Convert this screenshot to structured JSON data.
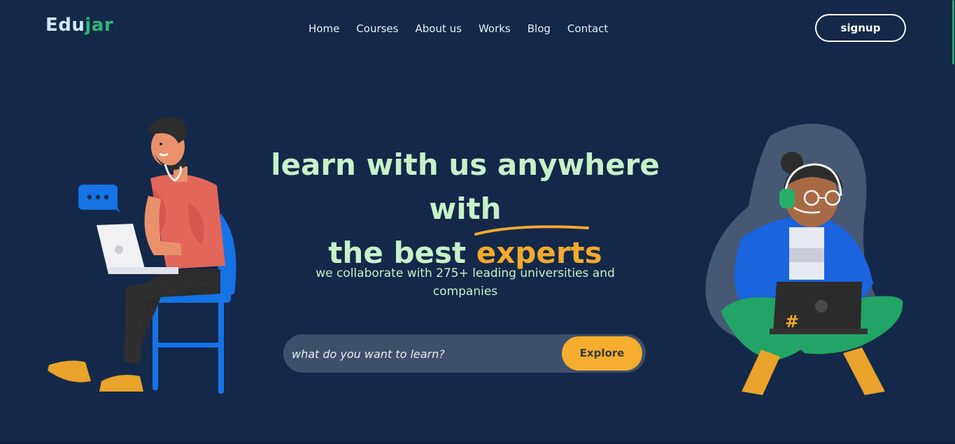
{
  "header": {
    "logo_part1": "Edu",
    "logo_part2": "jar",
    "nav": [
      "Home",
      "Courses",
      "About us",
      "Works",
      "Blog",
      "Contact"
    ],
    "signup_label": "signup"
  },
  "hero": {
    "headline_line1": "learn with us anywhere with",
    "headline_line2_prefix": "the best ",
    "headline_accent": "experts",
    "subtitle": "we collaborate with 275+ leading universities and companies"
  },
  "search": {
    "placeholder": "what do you want to learn?",
    "button_label": "Explore"
  },
  "illustrations": {
    "left_speech_bubble_icon": "chat-dots-icon",
    "right_laptop_icon": "hashtag-icon",
    "right_laptop_symbol": "#"
  },
  "colors": {
    "background": "#14284a",
    "brand_green": "#2fb57a",
    "headline": "#c6f1c9",
    "accent_orange": "#f2a92c",
    "search_bar": "#3d4f6b",
    "explore_button": "#f5ae2f"
  }
}
